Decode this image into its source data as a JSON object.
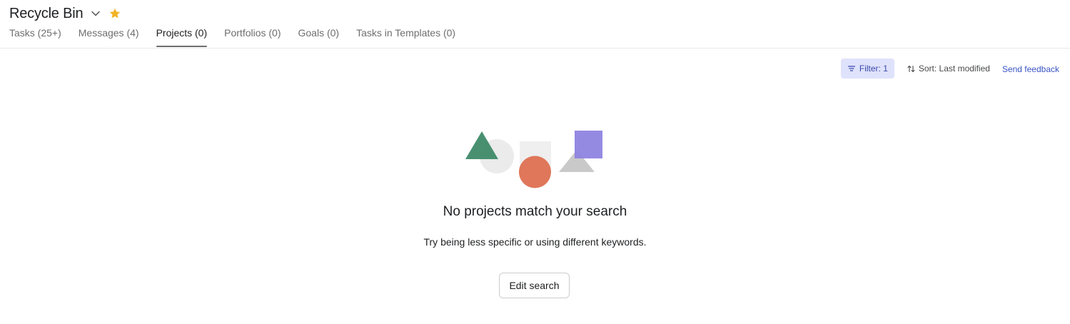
{
  "header": {
    "title": "Recycle Bin",
    "star_color": "#f2b325"
  },
  "tabs": [
    {
      "label": "Tasks (25+)",
      "active": false
    },
    {
      "label": "Messages (4)",
      "active": false
    },
    {
      "label": "Projects (0)",
      "active": true
    },
    {
      "label": "Portfolios (0)",
      "active": false
    },
    {
      "label": "Goals (0)",
      "active": false
    },
    {
      "label": "Tasks in Templates (0)",
      "active": false
    }
  ],
  "toolbar": {
    "filter_label": "Filter: 1",
    "sort_label": "Sort: Last modified",
    "feedback_label": "Send feedback"
  },
  "empty_state": {
    "heading": "No projects match your search",
    "subtext": "Try being less specific or using different keywords.",
    "button_label": "Edit search",
    "illustration_colors": {
      "triangle": "#3f8a68",
      "circle_gray": "#ebebeb",
      "square_gray": "#efefef",
      "circle_orange": "#e0775a",
      "triangle_gray": "#c9c9c9",
      "square_purple": "#8f84e0"
    }
  }
}
